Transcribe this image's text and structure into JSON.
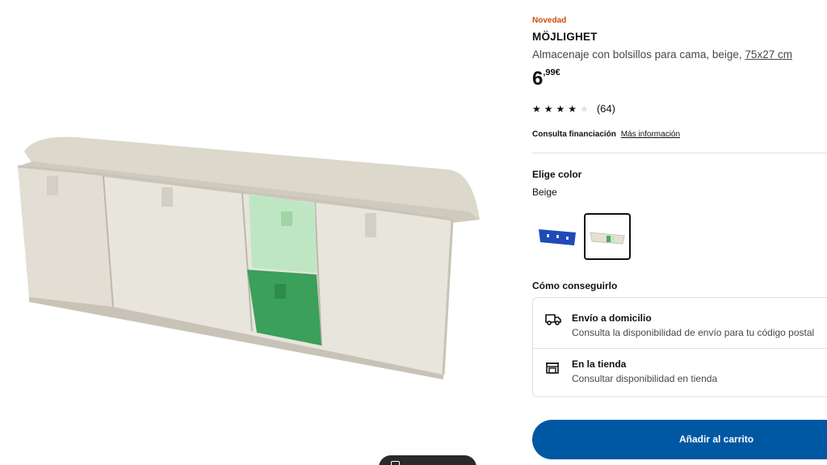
{
  "product": {
    "badge": "Novedad",
    "name": "MÖJLIGHET",
    "description": "Almacenaje con bolsillos para cama, beige,",
    "dimensions": "75x27 cm",
    "price_integer": "6",
    "price_decimal": ",99",
    "price_currency": "€",
    "rating": {
      "value": 4,
      "max": 5,
      "count": "(64)"
    }
  },
  "finance": {
    "label": "Consulta financiación",
    "link": "Más información"
  },
  "color": {
    "heading": "Elige color",
    "selected": "Beige",
    "options": [
      {
        "name": "blue",
        "hex": "#1f4bb8"
      },
      {
        "name": "beige",
        "hex": "#e4e0d6",
        "selected": true
      }
    ]
  },
  "delivery": {
    "heading": "Cómo conseguirlo",
    "shipping": {
      "title": "Envío a domicilio",
      "subtitle": "Consulta la disponibilidad de envío para tu código postal"
    },
    "store": {
      "title": "En la tienda",
      "subtitle": "Consultar disponibilidad en tienda"
    }
  },
  "cart": {
    "label": "Añadir al carrito"
  },
  "colors": {
    "accent": "#0058a3",
    "badge": "#ca5008",
    "text": "#111111",
    "muted": "#484848",
    "border": "#dfdfdf"
  }
}
